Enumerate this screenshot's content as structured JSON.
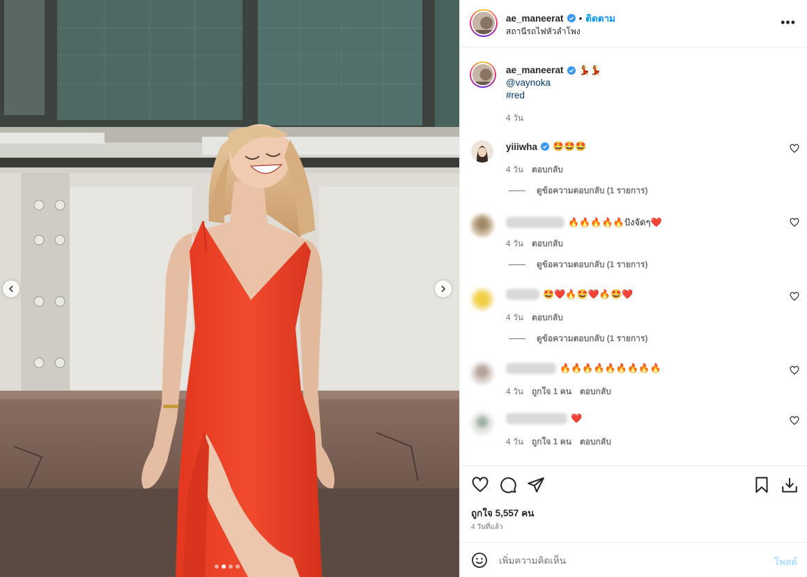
{
  "post": {
    "username": "ae_maneerat",
    "follow_label": "ติดตาม",
    "bullet": "•",
    "location": "สถานีรถไฟหัวลำโพง",
    "more_label": "•••"
  },
  "caption": {
    "username": "ae_maneerat",
    "emoji": "💃💃",
    "mention": "@vaynoka",
    "hashtag": "#red",
    "time": "4 วัน"
  },
  "comments": [
    {
      "username": "yiiiwha",
      "verified": true,
      "text": "🤩🤩🤩",
      "time": "4 วัน",
      "likes": "",
      "reply_label": "ตอบกลับ",
      "view_replies": "ดูข้อความตอบกลับ (1 รายการ)"
    },
    {
      "username": "",
      "verified": false,
      "text": "🔥🔥🔥🔥🔥ปังจัดๆ❤️",
      "time": "4 วัน",
      "likes": "",
      "reply_label": "ตอบกลับ",
      "view_replies": "ดูข้อความตอบกลับ (1 รายการ)"
    },
    {
      "username": "",
      "verified": false,
      "text": "🤩❤️🔥🤩❤️🔥🤩❤️",
      "time": "4 วัน",
      "likes": "",
      "reply_label": "ตอบกลับ",
      "view_replies": "ดูข้อความตอบกลับ (1 รายการ)"
    },
    {
      "username": "",
      "verified": false,
      "text": "🔥🔥🔥🔥🔥🔥🔥🔥🔥",
      "time": "4 วัน",
      "likes": "ถูกใจ 1 คน",
      "reply_label": "ตอบกลับ",
      "view_replies": ""
    },
    {
      "username": "",
      "verified": false,
      "text": "❤️",
      "time": "4 วัน",
      "likes": "ถูกใจ 1 คน",
      "reply_label": "ตอบกลับ",
      "view_replies": ""
    }
  ],
  "actions": {
    "likes_text": "ถูกใจ 5,557 คน",
    "time_ago": "4 วันที่แล้ว"
  },
  "add_comment": {
    "placeholder": "เพิ่มความคิดเห็น",
    "post_label": "โพสต์"
  },
  "carousel": {
    "slide_count": 4,
    "active_slide": 2
  },
  "colors": {
    "accent": "#0095f6",
    "verified": "#3897f0",
    "dress": "#e8432a"
  }
}
